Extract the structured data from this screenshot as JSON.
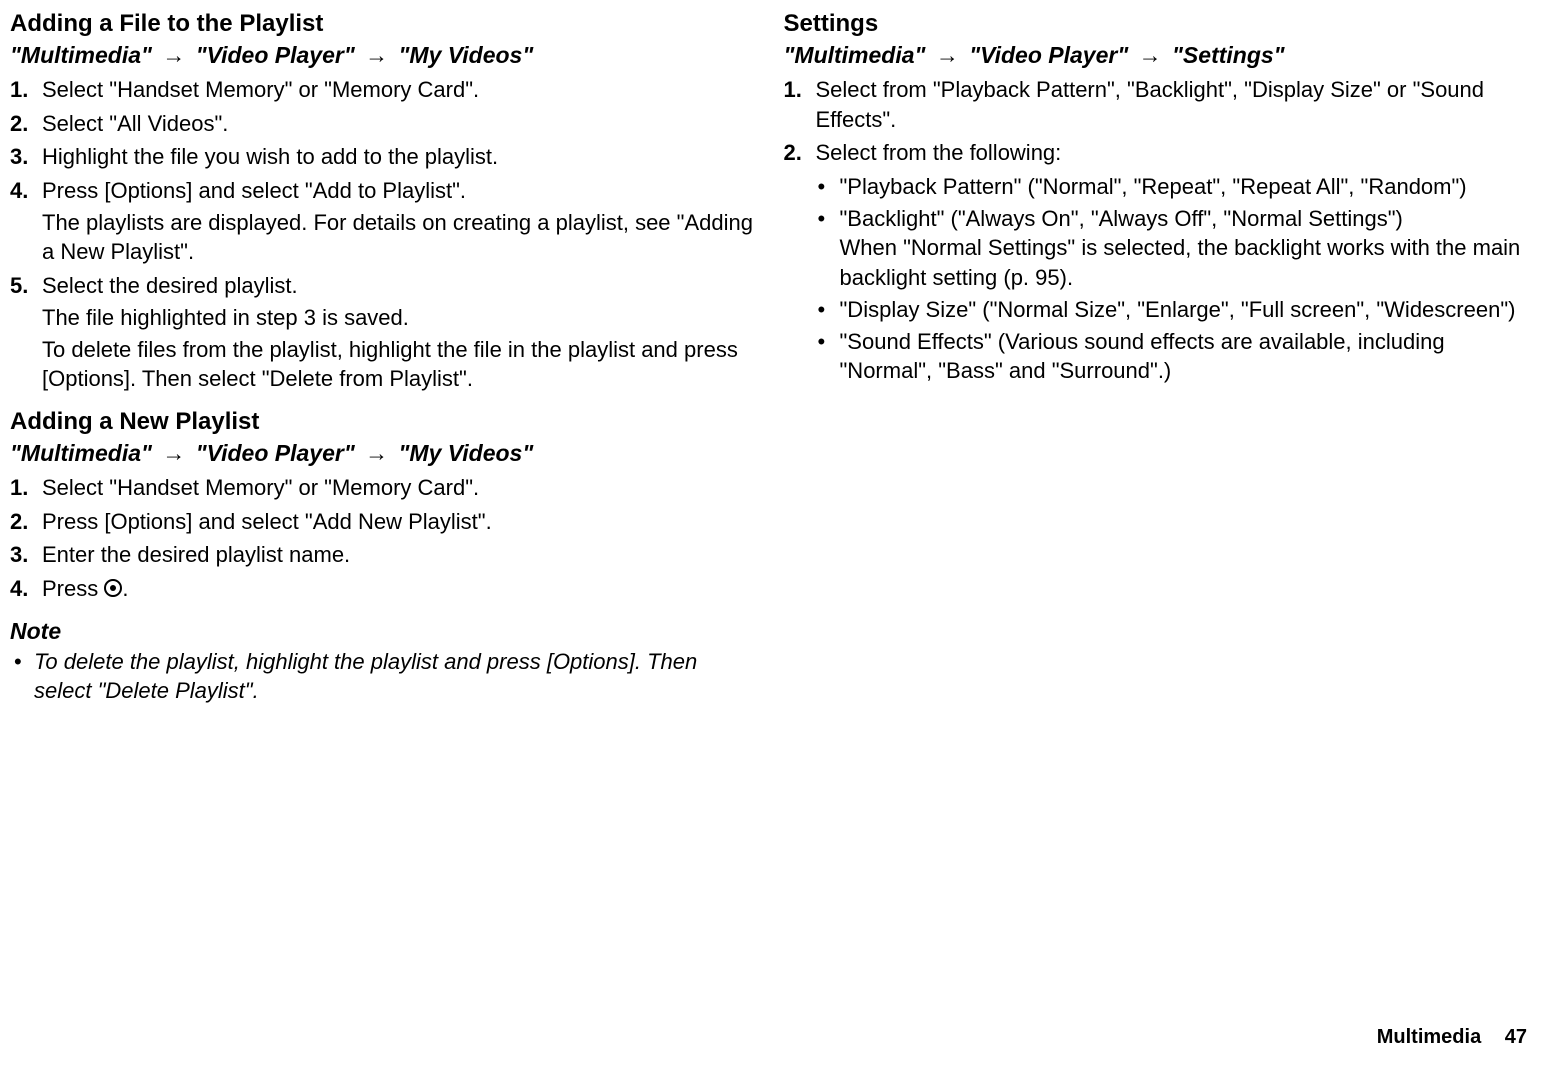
{
  "left": {
    "section1": {
      "title": "Adding a File to the Playlist",
      "nav1": "\"Multimedia\"",
      "nav2": "\"Video Player\"",
      "nav3": "\"My Videos\"",
      "steps": {
        "s1": "Select \"Handset Memory\" or \"Memory Card\".",
        "s2": "Select \"All Videos\".",
        "s3": "Highlight the file you wish to add to the playlist.",
        "s4": "Press [Options] and select \"Add to Playlist\".",
        "s4_detail": "The playlists are displayed. For details on creating a playlist, see \"Adding a New Playlist\".",
        "s5": "Select the desired playlist.",
        "s5_detail1": "The file highlighted in step 3 is saved.",
        "s5_detail2": "To delete files from the playlist, highlight the file in the playlist and press [Options]. Then select \"Delete from Playlist\"."
      }
    },
    "section2": {
      "title": "Adding a New Playlist",
      "nav1": "\"Multimedia\"",
      "nav2": "\"Video Player\"",
      "nav3": "\"My Videos\"",
      "steps": {
        "s1": "Select \"Handset Memory\" or \"Memory Card\".",
        "s2": "Press [Options] and select \"Add New Playlist\".",
        "s3": "Enter the desired playlist name.",
        "s4_prefix": "Press ",
        "s4_suffix": "."
      }
    },
    "note": {
      "title": "Note",
      "item1": "To delete the playlist, highlight the playlist and press [Options]. Then select \"Delete Playlist\"."
    }
  },
  "right": {
    "section1": {
      "title": "Settings",
      "nav1": "\"Multimedia\"",
      "nav2": "\"Video Player\"",
      "nav3": "\"Settings\"",
      "steps": {
        "s1": "Select from \"Playback Pattern\", \"Backlight\", \"Display Size\" or \"Sound Effects\".",
        "s2": "Select from the following:"
      },
      "bullets": {
        "b1": "\"Playback Pattern\" (\"Normal\", \"Repeat\", \"Repeat All\", \"Random\")",
        "b2a": "\"Backlight\" (\"Always On\", \"Always Off\", \"Normal Settings\")",
        "b2b": "When \"Normal Settings\" is selected, the backlight works with the main backlight setting (p. 95).",
        "b3": "\"Display Size\" (\"Normal Size\", \"Enlarge\", \"Full screen\", \"Widescreen\")",
        "b4": "\"Sound Effects\" (Various sound effects are available, including \"Normal\", \"Bass\" and \"Surround\".)"
      }
    }
  },
  "footer": {
    "label": "Multimedia",
    "page": "47"
  }
}
